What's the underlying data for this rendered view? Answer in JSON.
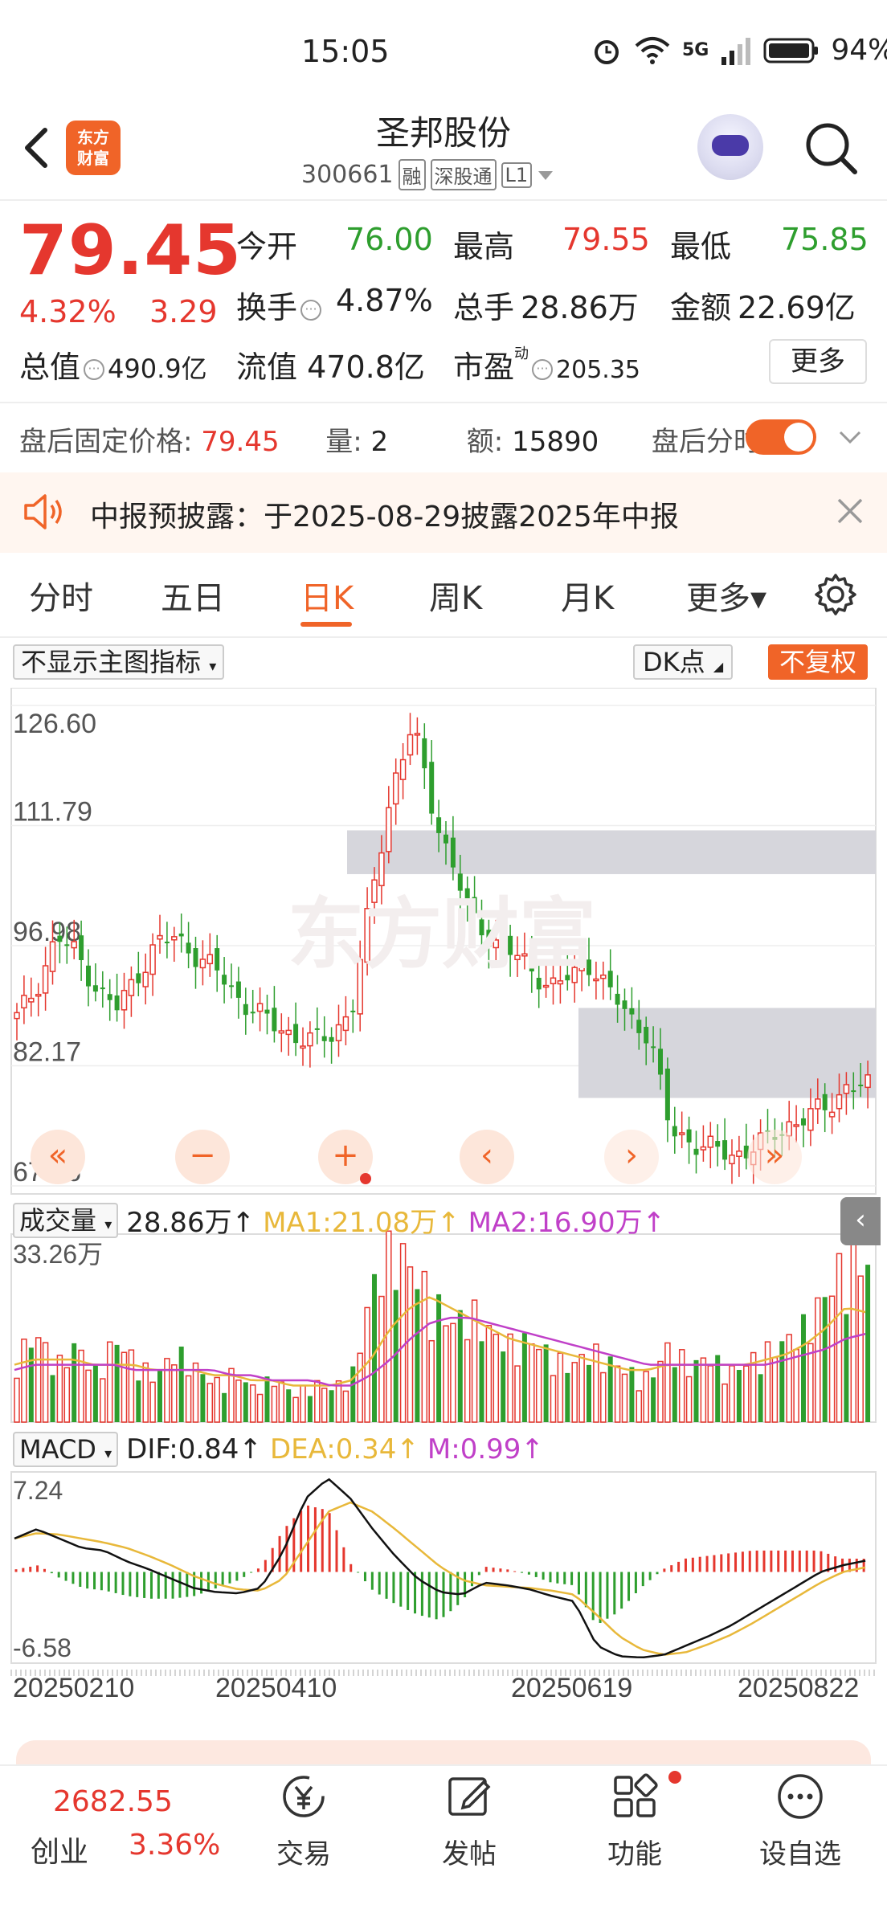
{
  "status_bar": {
    "time": "15:05",
    "battery": "94%",
    "network": "5G"
  },
  "header": {
    "title": "圣邦股份",
    "code": "300661",
    "tags": [
      "融",
      "深股通",
      "L1"
    ],
    "logo_text": "东方财富"
  },
  "quote": {
    "price": "79.45",
    "pct": "4.32%",
    "change": "3.29",
    "rows": [
      [
        {
          "label": "今开",
          "value": "76.00",
          "color": "green"
        },
        {
          "label": "最高",
          "value": "79.55",
          "color": "red"
        },
        {
          "label": "最低",
          "value": "75.85",
          "color": "green"
        }
      ],
      [
        {
          "label": "换手",
          "value": "4.87%",
          "color": "black"
        },
        {
          "label": "总手",
          "value": "28.86万",
          "color": "black"
        },
        {
          "label": "金额",
          "value": "22.69亿",
          "color": "black"
        }
      ]
    ],
    "market_cap_label": "总值",
    "market_cap": "490.9亿",
    "float_cap_label": "流值",
    "float_cap": "470.8亿",
    "pe_label": "市盈",
    "pe_sup": "动",
    "pe": "205.35",
    "more_label": "更多"
  },
  "after_hours": {
    "price_label": "盘后固定价格:",
    "price": "79.45",
    "vol_label": "量:",
    "vol": "2",
    "amt_label": "额:",
    "amt": "15890",
    "toggle_label": "盘后分时",
    "toggle_on": true
  },
  "notice": {
    "text": "中报预披露：于2025-08-29披露2025年中报"
  },
  "tabs": [
    "分时",
    "五日",
    "日K",
    "周K",
    "月K",
    "更多▾"
  ],
  "active_tab": "日K",
  "chart_controls": {
    "indicator_label": "不显示主图指标",
    "dk_label": "DK点",
    "adjust_label": "不复权"
  },
  "watermark": "东方财富",
  "chart_data": [
    {
      "type": "candlestick",
      "title": "日K",
      "y_ticks": [
        "126.60",
        "111.79",
        "96.98",
        "82.17",
        "67.36"
      ],
      "ylim": [
        67.36,
        126.6
      ],
      "x_ticks": [
        "20250210",
        "20250410",
        "20250619",
        "20250822"
      ],
      "close_trend": [
        88,
        92,
        98,
        96,
        92,
        89,
        93,
        97,
        98,
        96,
        94,
        91,
        89,
        87,
        86,
        85,
        86,
        90,
        104,
        117,
        124,
        114,
        107,
        100,
        98,
        96,
        94,
        92,
        93,
        95,
        91,
        88,
        86,
        74,
        73,
        72,
        71,
        72,
        73,
        75,
        76,
        77,
        80,
        79.45
      ],
      "gaps": [
        {
          "from": 105.8,
          "to": 111.2
        },
        {
          "from": 78.2,
          "to": 89.3
        }
      ]
    },
    {
      "type": "bar",
      "title": "成交量",
      "current": "28.86万",
      "ma1_label": "MA1:21.08万",
      "ma2_label": "MA2:16.90万",
      "max_label": "33.26万",
      "ylim": [
        0,
        33.26
      ],
      "values": [
        12,
        16,
        10,
        14,
        9,
        15,
        11,
        8,
        13,
        10,
        7,
        9,
        6,
        8,
        5,
        7,
        6,
        9,
        25,
        32,
        28,
        22,
        18,
        20,
        16,
        14,
        15,
        12,
        10,
        13,
        11,
        9,
        8,
        14,
        10,
        12,
        9,
        11,
        13,
        15,
        18,
        24,
        30,
        28.86
      ],
      "ma1": [
        11,
        12,
        12,
        12,
        11,
        11,
        11,
        10,
        10,
        10,
        9,
        9,
        8,
        8,
        7,
        7,
        7,
        8,
        12,
        18,
        22,
        24,
        22,
        20,
        18,
        16,
        15,
        14,
        13,
        12,
        11,
        10,
        10,
        11,
        11,
        11,
        11,
        11,
        12,
        13,
        15,
        18,
        22,
        21.08
      ],
      "ma2": [
        10,
        11,
        11,
        11,
        11,
        11,
        10,
        10,
        10,
        10,
        10,
        9,
        9,
        8,
        8,
        8,
        7,
        7,
        9,
        12,
        16,
        19,
        20,
        20,
        19,
        18,
        17,
        16,
        15,
        14,
        13,
        12,
        11,
        11,
        11,
        11,
        11,
        11,
        11,
        12,
        13,
        14,
        16,
        16.9
      ]
    },
    {
      "type": "line",
      "title": "MACD",
      "dif_label": "DIF:0.84",
      "dea_label": "DEA:0.34",
      "m_label": "M:0.99",
      "y_ticks": [
        "7.24",
        "-6.58"
      ],
      "ylim": [
        -6.58,
        7.24
      ],
      "dif": [
        2.5,
        3.2,
        2.5,
        1.8,
        1.6,
        0.8,
        0.2,
        -0.5,
        -1.2,
        -1.5,
        -1.6,
        -1.2,
        1.5,
        5.5,
        7.0,
        5.5,
        3.2,
        1.2,
        -0.5,
        -1.5,
        -1.7,
        -0.8,
        -1.0,
        -1.3,
        -1.8,
        -2.2,
        -5.5,
        -6.3,
        -6.4,
        -6.2,
        -5.5,
        -4.8,
        -4.0,
        -3.0,
        -2.0,
        -1.0,
        0.0,
        0.5,
        0.84
      ],
      "dea": [
        2.5,
        2.9,
        2.8,
        2.5,
        2.2,
        1.8,
        1.2,
        0.5,
        -0.3,
        -0.9,
        -1.3,
        -1.4,
        -0.5,
        2.0,
        4.5,
        5.2,
        4.5,
        3.2,
        1.8,
        0.4,
        -0.6,
        -1.0,
        -1.1,
        -1.2,
        -1.4,
        -1.7,
        -3.2,
        -4.8,
        -5.8,
        -6.2,
        -6.0,
        -5.4,
        -4.7,
        -3.8,
        -2.8,
        -1.8,
        -0.8,
        0.0,
        0.34
      ],
      "macd_hist": [
        0.2,
        0.5,
        -0.5,
        -1.2,
        -1.4,
        -1.8,
        -2.0,
        -2.0,
        -1.8,
        -1.2,
        -0.6,
        0.4,
        3.2,
        5.0,
        4.6,
        0.6,
        -1.4,
        -2.4,
        -3.2,
        -3.6,
        -2.2,
        0.4,
        0.2,
        -0.2,
        -0.8,
        -1.0,
        -4.0,
        -3.0,
        -1.2,
        0.2,
        1.0,
        1.2,
        1.4,
        1.6,
        1.6,
        1.6,
        1.6,
        1.0,
        0.99
      ]
    }
  ],
  "bottom_bar": {
    "index_value": "2682.55",
    "index_name": "创业",
    "index_pct": "3.36%",
    "items": [
      "交易",
      "发帖",
      "功能",
      "设自选"
    ]
  },
  "colors": {
    "accent": "#f06428",
    "up": "#e5372e",
    "down": "#2e9e2e",
    "ma1": "#e8b83a",
    "ma2": "#c040c8"
  }
}
